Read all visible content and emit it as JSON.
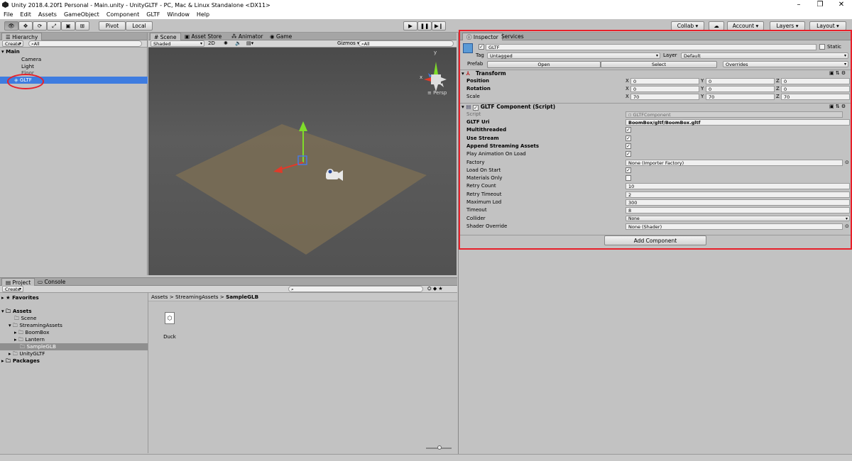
{
  "window": {
    "title": "Unity 2018.4.20f1 Personal - Main.unity - UnityGLTF - PC, Mac & Linux Standalone <DX11>"
  },
  "menu": [
    "File",
    "Edit",
    "Assets",
    "GameObject",
    "Component",
    "GLTF",
    "Window",
    "Help"
  ],
  "toolbar": {
    "pivot": "Pivot",
    "local": "Local",
    "collab": "Collab",
    "account": "Account",
    "layers": "Layers",
    "layout": "Layout"
  },
  "hierarchy": {
    "tab": "Hierarchy",
    "create": "Create",
    "search": "All",
    "scene": "Main",
    "items": [
      "Camera",
      "Light",
      "Floor",
      "GLTF"
    ]
  },
  "scene_view": {
    "tabs": [
      "Scene",
      "Asset Store",
      "Animator",
      "Game"
    ],
    "shading": "Shaded",
    "mode": "2D",
    "gizmos": "Gizmos",
    "search": "All",
    "persp": "Persp",
    "axis_y": "y",
    "axis_x": "x"
  },
  "project": {
    "tabs": [
      "Project",
      "Console"
    ],
    "create": "Create",
    "favorites": "Favorites",
    "assets": "Assets",
    "tree": [
      "Scene",
      "StreamingAssets",
      "BoomBox",
      "Lantern",
      "SampleGLB",
      "UnityGLTF"
    ],
    "packages": "Packages",
    "breadcrumb": [
      "Assets",
      "StreamingAssets",
      "SampleGLB"
    ],
    "file": "Duck"
  },
  "inspector": {
    "tabs": [
      "Inspector",
      "Services"
    ],
    "object_name": "GLTF",
    "static": "Static",
    "tag_label": "Tag",
    "tag": "Untagged",
    "layer_label": "Layer",
    "layer": "Default",
    "prefab_label": "Prefab",
    "prefab_open": "Open",
    "prefab_select": "Select",
    "prefab_overrides": "Overrides",
    "transform": {
      "title": "Transform",
      "rows": [
        {
          "label": "Position",
          "x": "0",
          "y": "0",
          "z": "0"
        },
        {
          "label": "Rotation",
          "x": "0",
          "y": "0",
          "z": "0"
        },
        {
          "label": "Scale",
          "x": "70",
          "y": "70",
          "z": "70"
        }
      ]
    },
    "component": {
      "title": "GLTF Component (Script)",
      "script_label": "Script",
      "script_value": "GLTFComponent",
      "rows": [
        {
          "label": "GLTF Uri",
          "bold": true,
          "type": "text",
          "value": "BoomBox/gltf/BoomBox.gltf"
        },
        {
          "label": "Multithreaded",
          "bold": true,
          "type": "check",
          "value": true
        },
        {
          "label": "Use Stream",
          "bold": true,
          "type": "check",
          "value": true
        },
        {
          "label": "Append Streaming Assets",
          "bold": true,
          "type": "check",
          "value": true
        },
        {
          "label": "Play Animation On Load",
          "bold": false,
          "type": "check",
          "value": true
        },
        {
          "label": "Factory",
          "bold": false,
          "type": "object",
          "value": "None (Importer Factory)"
        },
        {
          "label": "Load On Start",
          "bold": false,
          "type": "check",
          "value": true
        },
        {
          "label": "Materials Only",
          "bold": false,
          "type": "check",
          "value": false
        },
        {
          "label": "Retry Count",
          "bold": false,
          "type": "text",
          "value": "10"
        },
        {
          "label": "Retry Timeout",
          "bold": false,
          "type": "text",
          "value": "2"
        },
        {
          "label": "Maximum Lod",
          "bold": false,
          "type": "text",
          "value": "300"
        },
        {
          "label": "Timeout",
          "bold": false,
          "type": "text",
          "value": "8"
        },
        {
          "label": "Collider",
          "bold": false,
          "type": "dropdown",
          "value": "None"
        },
        {
          "label": "Shader Override",
          "bold": false,
          "type": "object",
          "value": "None (Shader)"
        }
      ]
    },
    "add_component": "Add Component"
  },
  "colors": {
    "highlight": "#e8202a",
    "selection": "#3e7ce0",
    "background": "#c2c2c2"
  }
}
